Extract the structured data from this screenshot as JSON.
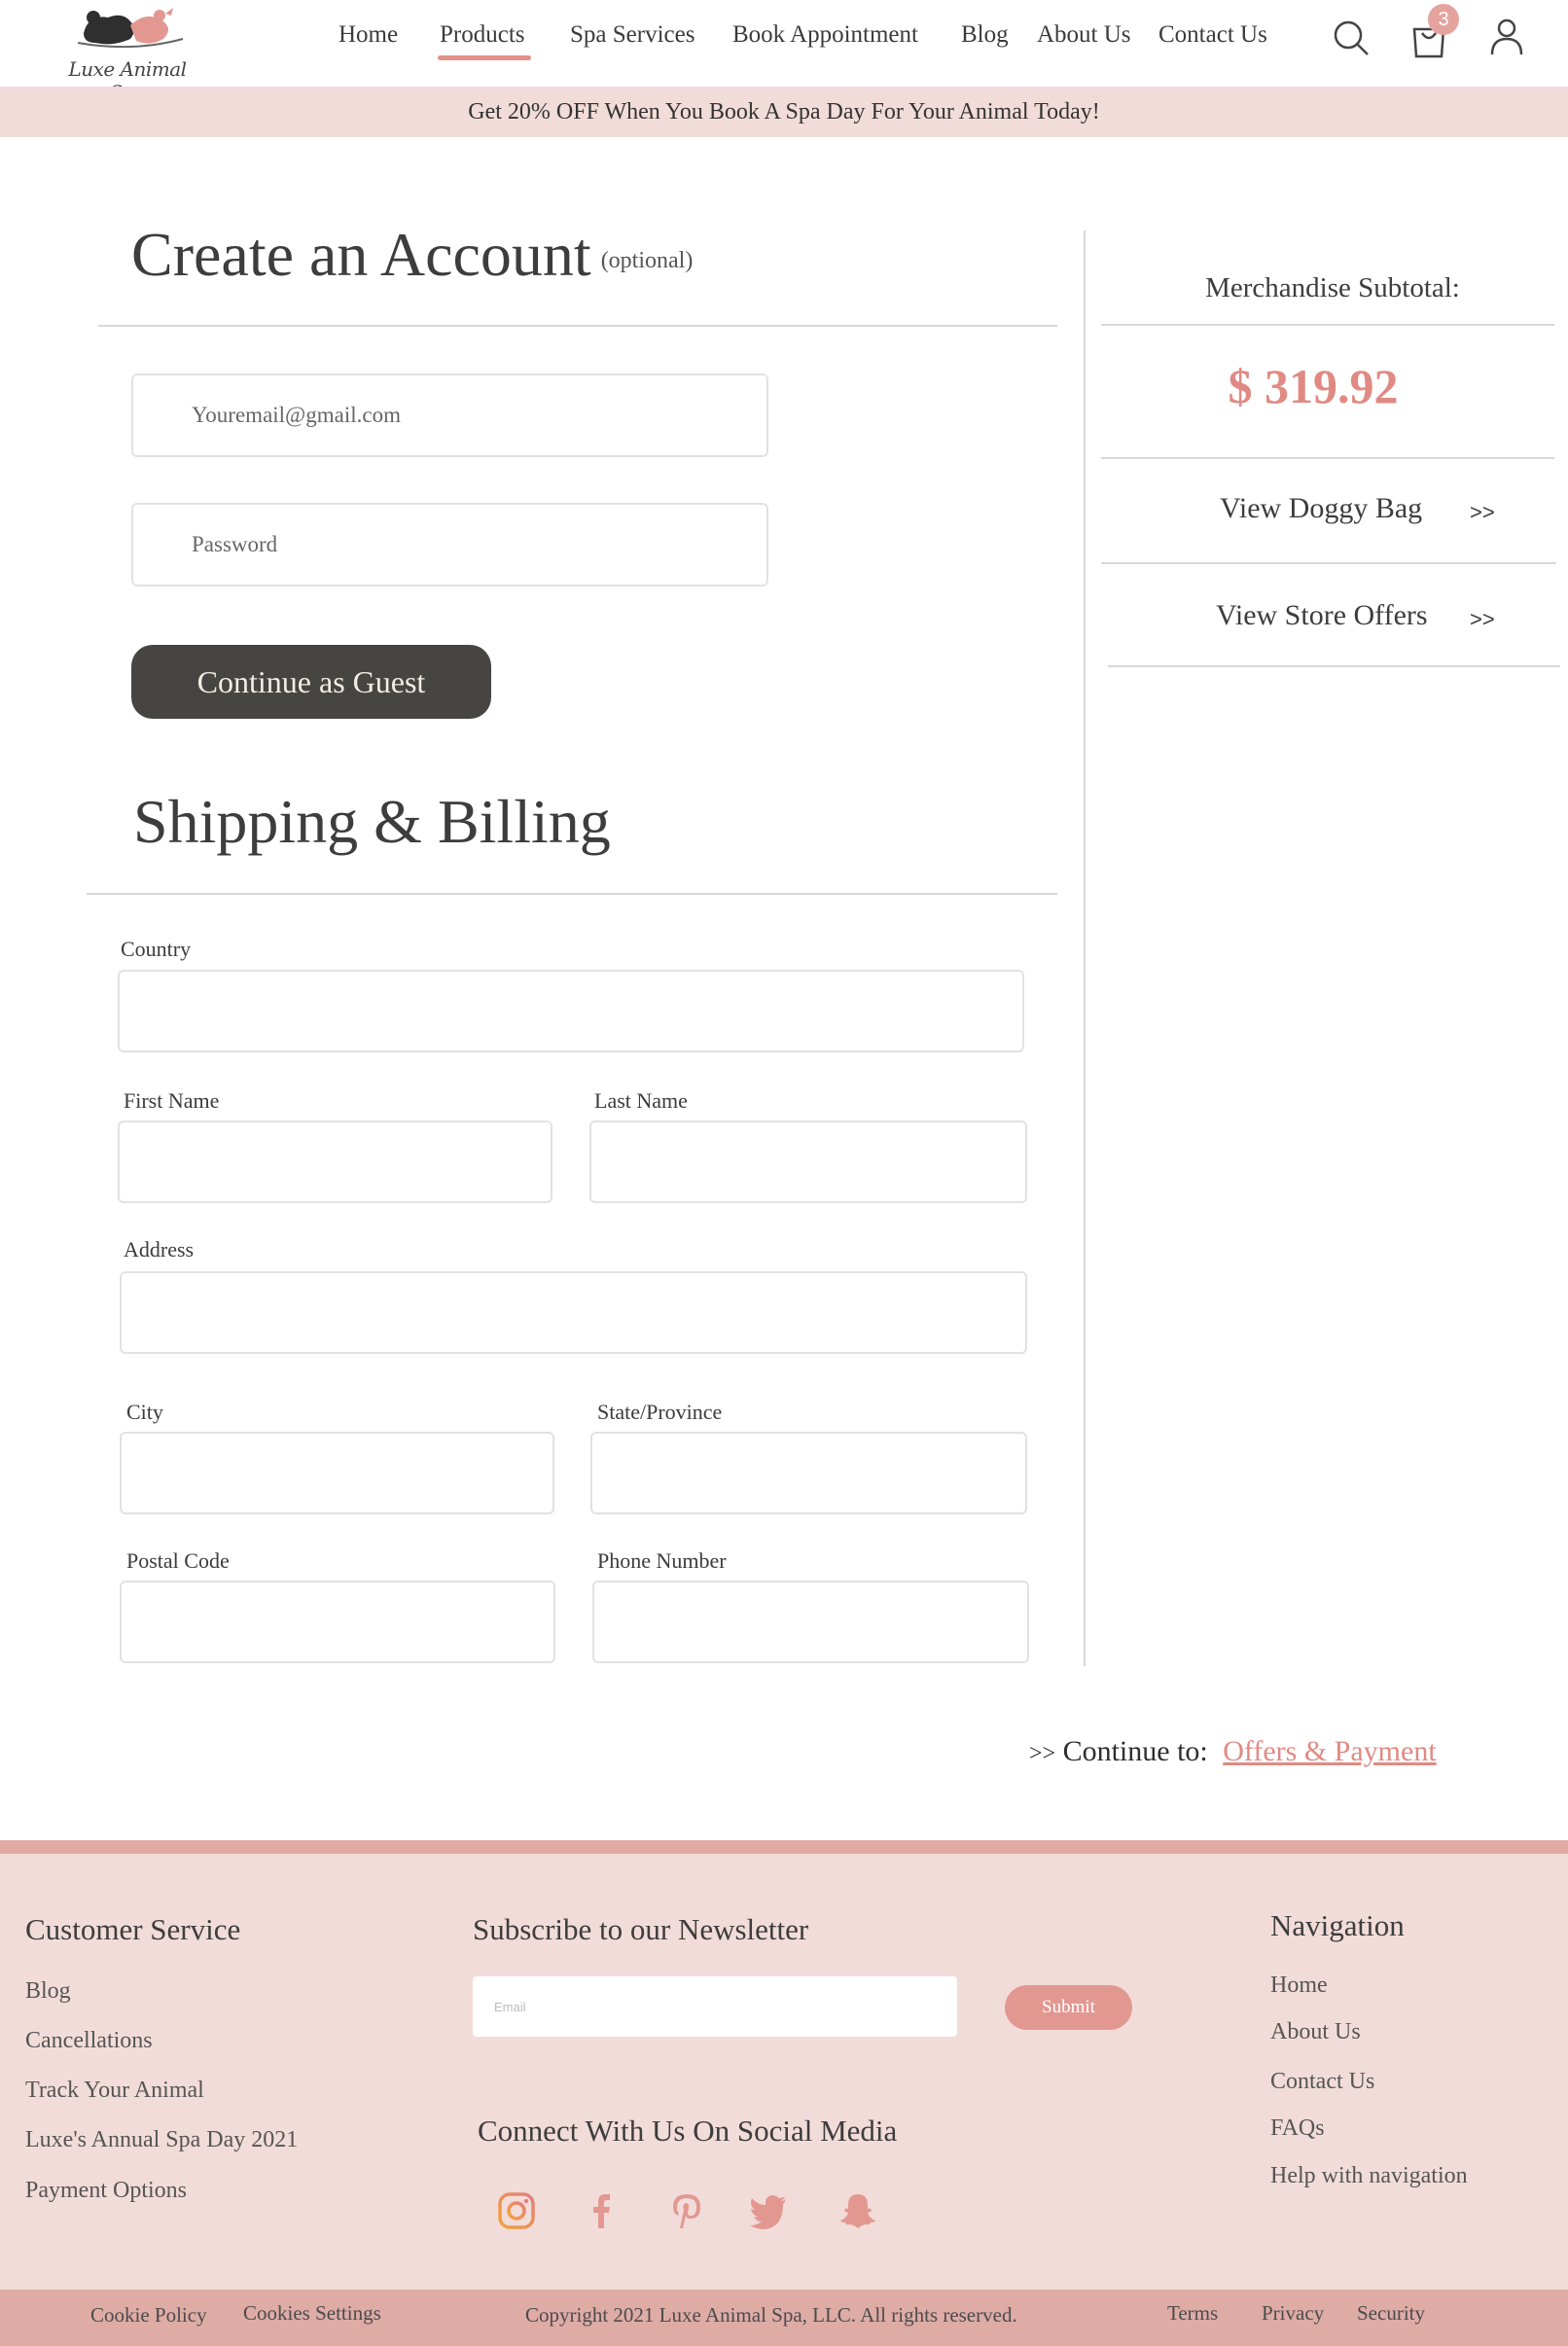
{
  "brand": {
    "name": "Luxe Animal Spa",
    "accent": "#e08a83",
    "dark": "#464542",
    "pink_bg": "#f2dcd9"
  },
  "nav": {
    "items": [
      {
        "label": "Home"
      },
      {
        "label": "Products",
        "active": true
      },
      {
        "label": "Spa Services"
      },
      {
        "label": "Book Appointment"
      },
      {
        "label": "Blog"
      },
      {
        "label": "About Us"
      },
      {
        "label": "Contact Us"
      }
    ],
    "icons": [
      "search-icon",
      "cart-icon",
      "user-icon"
    ],
    "cart_count": "3"
  },
  "promo": "Get 20% OFF When You Book A Spa Day For Your Animal Today!",
  "account": {
    "title": "Create an Account",
    "optional": "(optional)",
    "email_placeholder": "Youremail@gmail.com",
    "password_placeholder": "Password",
    "guest_button": "Continue as Guest"
  },
  "shipping": {
    "title": "Shipping & Billing",
    "fields": {
      "country": "Country",
      "first_name": "First Name",
      "last_name": "Last Name",
      "address": "Address",
      "city": "City",
      "state": "State/Province",
      "postal": "Postal Code",
      "phone": "Phone Number"
    }
  },
  "sidebar": {
    "subtotal_label": "Merchandise Subtotal:",
    "subtotal_value": "$ 319.92",
    "doggy_bag": "View Doggy Bag",
    "store_offers": "View Store Offers",
    "arrow": ">>"
  },
  "continue": {
    "prefix": ">>",
    "label": "Continue to:",
    "link": "Offers & Payment"
  },
  "footer": {
    "customer_service": {
      "title": "Customer Service",
      "links": [
        "Blog",
        "Cancellations",
        "Track Your Animal",
        "Luxe's Annual Spa Day 2021",
        "Payment Options"
      ]
    },
    "newsletter": {
      "title": "Subscribe to our Newsletter",
      "placeholder": "Email",
      "submit": "Submit"
    },
    "social": {
      "title": "Connect With Us On Social Media",
      "icons": [
        "instagram-icon",
        "facebook-icon",
        "pinterest-icon",
        "twitter-icon",
        "snapchat-icon"
      ]
    },
    "navigation": {
      "title": "Navigation",
      "links": [
        "Home",
        "About Us",
        "Contact Us",
        "FAQs",
        "Help with navigation"
      ]
    },
    "bottom": {
      "cookie_policy": "Cookie Policy",
      "cookie_settings": "Cookies Settings",
      "copyright": "Copyright 2021 Luxe Animal Spa, LLC. All rights reserved.",
      "terms": "Terms",
      "privacy": "Privacy",
      "security": "Security"
    }
  }
}
